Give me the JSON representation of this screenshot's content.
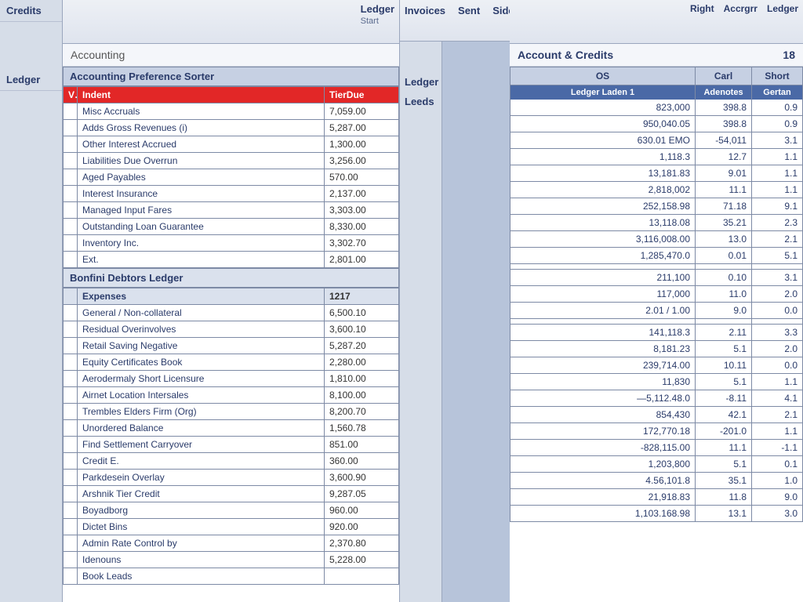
{
  "left_strip": {
    "tabs": [
      "Credits",
      "Ledger"
    ]
  },
  "left_pane": {
    "header": {
      "title": "Ledger",
      "sub": "Start"
    },
    "breadcrumb": "Accounting",
    "section1_title": "Accounting Preference Sorter",
    "table1": {
      "headers": [
        "Indent",
        "TierDue"
      ],
      "rows": [
        {
          "name": "Misc Accruals",
          "val": "7,059.00"
        },
        {
          "name": "Adds Gross Revenues (i)",
          "val": "5,287.00"
        },
        {
          "name": "Other Interest Accrued",
          "val": "1,300.00"
        },
        {
          "name": "Liabilities Due Overrun",
          "val": "3,256.00"
        },
        {
          "name": "Aged Payables",
          "val": "570.00"
        },
        {
          "name": "Interest Insurance",
          "val": "2,137.00"
        },
        {
          "name": "Managed Input Fares",
          "val": "3,303.00"
        },
        {
          "name": "Outstanding Loan Guarantee",
          "val": "8,330.00"
        },
        {
          "name": "Inventory Inc.",
          "val": "3,302.70"
        },
        {
          "name": "Ext.",
          "val": "2,801.00"
        }
      ]
    },
    "section2_title": "Bonfini Debtors Ledger",
    "subhead": {
      "name": "Expenses",
      "val": "1217"
    },
    "table2": {
      "rows": [
        {
          "name": "General / Non-collateral",
          "val": "6,500.10"
        },
        {
          "name": "Residual Overinvolves",
          "val": "3,600.10"
        },
        {
          "name": "Retail Saving Negative",
          "val": "5,287.20"
        },
        {
          "name": "Equity Certificates Book",
          "val": "2,280.00"
        },
        {
          "name": "Aerodermaly Short Licensure",
          "val": "1,810.00"
        },
        {
          "name": "Airnet Location Intersales",
          "val": "8,100.00"
        },
        {
          "name": "Trembles Elders Firm (Org)",
          "val": "8,200.70"
        },
        {
          "name": "Unordered Balance",
          "val": "1,560.78"
        },
        {
          "name": "Find Settlement Carryover",
          "val": "851.00"
        },
        {
          "name": "Credit E.",
          "val": "360.00"
        },
        {
          "name": "Parkdesein Overlay",
          "val": "3,600.90"
        },
        {
          "name": "Arshnik Tier Credit",
          "val": "9,287.05"
        },
        {
          "name": "Boyadborg",
          "val": "960.00"
        },
        {
          "name": "Dictet Bins",
          "val": "920.00"
        },
        {
          "name": "Admin Rate Control by",
          "val": "2,370.80"
        },
        {
          "name": "Idenouns",
          "val": "5,228.00"
        },
        {
          "name": "Book Leads",
          "val": ""
        }
      ]
    }
  },
  "mid_pane": {
    "tabs": [
      "Invoices",
      "Sent",
      "Sidebar"
    ],
    "side_tabs": [
      "Ledger",
      "Leeds"
    ]
  },
  "right_pane": {
    "header": {
      "c1": "Right",
      "c2": "Accrgrr",
      "c3": "Ledger"
    },
    "breadcrumb": {
      "title": "Account & Credits",
      "num": "18"
    },
    "col_hdr": [
      "OS",
      "Carl",
      "Short"
    ],
    "sub_hdr": [
      "Ledger Laden 1",
      "Adenotes",
      "Gertan"
    ],
    "rows": [
      [
        "823,000",
        "398.8",
        "0.9"
      ],
      [
        "950,040.05",
        "398.8",
        "0.9"
      ],
      [
        "630.01 EMO",
        "-54,011",
        "3.1"
      ],
      [
        "1,118.3",
        "12.7",
        "1.1"
      ],
      [
        "13,181.83",
        "9.01",
        "1.1"
      ],
      [
        "2,818,002",
        "11.1",
        "1.1"
      ],
      [
        "252,158.98",
        "71.18",
        "9.1"
      ],
      [
        "13,118.08",
        "35.21",
        "2.3"
      ],
      [
        "3,116,008.00",
        "13.0",
        "2.1"
      ],
      [
        "1,285,470.0",
        "0.01",
        "5.1"
      ],
      [
        "",
        "",
        ""
      ],
      [
        "211,100",
        "0.10",
        "3.1"
      ],
      [
        "117,000",
        "11.0",
        "2.0"
      ],
      [
        "2.01 / 1.00",
        "9.0",
        "0.0"
      ],
      [
        "",
        "",
        ""
      ],
      [
        "141,118.3",
        "2.11",
        "3.3"
      ],
      [
        "8,181.23",
        "5.1",
        "2.0"
      ],
      [
        "239,714.00",
        "10.11",
        "0.0"
      ],
      [
        "11,830",
        "5.1",
        "1.1"
      ],
      [
        "—5,112.48.0",
        "-8.11",
        "4.1"
      ],
      [
        "854,430",
        "42.1",
        "2.1"
      ],
      [
        "172,770.18",
        "-201.0",
        "1.1"
      ],
      [
        "-828,115.00",
        "11.1",
        "-1.1"
      ],
      [
        "1,203,800",
        "5.1",
        "0.1"
      ],
      [
        "4.56,101.8",
        "35.1",
        "1.0"
      ],
      [
        "21,918.83",
        "11.8",
        "9.0"
      ],
      [
        "1,103.168.98",
        "13.1",
        "3.0"
      ]
    ]
  }
}
